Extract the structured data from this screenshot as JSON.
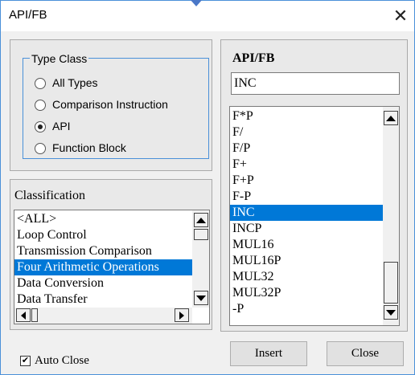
{
  "window": {
    "title": "API/FB",
    "close_glyph": "✕"
  },
  "type_class": {
    "legend": "Type Class",
    "options": [
      {
        "label": "All Types",
        "selected": false
      },
      {
        "label": "Comparison Instruction",
        "selected": false
      },
      {
        "label": "API",
        "selected": true
      },
      {
        "label": "Function Block",
        "selected": false
      }
    ]
  },
  "classification": {
    "label": "Classification",
    "items": [
      "<ALL>",
      "Loop Control",
      "Transmission Comparison",
      "Four Arithmetic Operations",
      "Data Conversion",
      "Data Transfer"
    ],
    "selected_index": 3
  },
  "api_fb": {
    "label": "API/FB",
    "input_value": "INC",
    "items": [
      "F*P",
      "F/",
      "F/P",
      "F+",
      "F+P",
      "F-P",
      "INC",
      "INCP",
      "MUL16",
      "MUL16P",
      "MUL32",
      "MUL32P",
      "-P"
    ],
    "selected_index": 6
  },
  "auto_close": {
    "label": "Auto Close",
    "checked": true
  },
  "buttons": {
    "insert": "Insert",
    "close": "Close"
  },
  "colors": {
    "selection": "#0078d7",
    "accent_border": "#4a90d9"
  },
  "icons": {
    "checkbox_mark": "✔"
  }
}
